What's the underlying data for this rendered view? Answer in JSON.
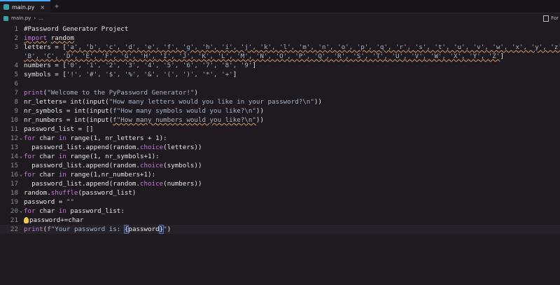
{
  "tab": {
    "title": "main.py",
    "close": "×",
    "new": "+"
  },
  "breadcrumbs": {
    "file": "main.py",
    "sep": "›",
    "more": "..."
  },
  "right_panel": {
    "label": "For"
  },
  "editor": {
    "lines": [
      {
        "n": "1",
        "tokens": [
          {
            "t": "#Password Generator Project",
            "c": "cm"
          }
        ]
      },
      {
        "n": "2",
        "tokens": [
          {
            "t": "import",
            "c": "kw sq"
          },
          {
            "t": " ",
            "c": "id"
          },
          {
            "t": "random",
            "c": "id sq"
          }
        ]
      },
      {
        "n": "3",
        "tokens": [
          {
            "t": "letters = [",
            "c": "id"
          },
          {
            "t": "'a', 'b', 'c', 'd', 'e', 'f', 'g', 'h', 'i', 'j', 'k', 'l', 'm', 'n', 'o', 'p', 'q', 'r', 's', 't', 'u', 'v', 'w', 'x', 'y', 'z', 'A',",
            "c": "str sq"
          }
        ]
      },
      {
        "n": "",
        "tokens": [
          {
            "t": "'B', 'C', 'D', 'E', 'F', 'G', 'H', 'I', 'J', 'K', 'L', 'M', 'N', 'O', 'P', 'Q', 'R', 'S', 'T', 'U', 'V', 'W', 'X', 'Y', 'Z'",
            "c": "str sq"
          },
          {
            "t": "]",
            "c": "id"
          }
        ]
      },
      {
        "n": "4",
        "tokens": [
          {
            "t": "numbers = [",
            "c": "id"
          },
          {
            "t": "'0', '1', '2', '3', '4', '5', '6', '7', '8', '9'",
            "c": "str"
          },
          {
            "t": "]",
            "c": "id"
          }
        ]
      },
      {
        "n": "5",
        "tokens": [
          {
            "t": "symbols = [",
            "c": "id"
          },
          {
            "t": "'!', '#', '$', '%', '&', '(', ')', '*', '+'",
            "c": "str"
          },
          {
            "t": "]",
            "c": "id"
          }
        ]
      },
      {
        "n": "6",
        "tokens": []
      },
      {
        "n": "7",
        "tokens": [
          {
            "t": "print",
            "c": "kw"
          },
          {
            "t": "(",
            "c": "id"
          },
          {
            "t": "\"Welcome to the PyPassword Generator!\"",
            "c": "str"
          },
          {
            "t": ")",
            "c": "id"
          }
        ]
      },
      {
        "n": "8",
        "tokens": [
          {
            "t": "nr_letters= int(input(",
            "c": "id"
          },
          {
            "t": "\"How many letters would you like in your password?\\n\"",
            "c": "str"
          },
          {
            "t": "))",
            "c": "id"
          }
        ]
      },
      {
        "n": "9",
        "tokens": [
          {
            "t": "nr_symbols = int(input(",
            "c": "id"
          },
          {
            "t": "f\"How many symbols would you like?\\n\"",
            "c": "str"
          },
          {
            "t": "))",
            "c": "id"
          }
        ]
      },
      {
        "n": "10",
        "tokens": [
          {
            "t": "nr_numbers = int(input(",
            "c": "id"
          },
          {
            "t": "f\"How many numbers would you like?\\n\"",
            "c": "str sq"
          },
          {
            "t": "))",
            "c": "id"
          }
        ]
      },
      {
        "n": "11",
        "tokens": [
          {
            "t": "password_list = []",
            "c": "id"
          }
        ]
      },
      {
        "n": "12",
        "fold": "⌄",
        "tokens": [
          {
            "t": "for",
            "c": "kw"
          },
          {
            "t": " char ",
            "c": "id"
          },
          {
            "t": "in",
            "c": "kw"
          },
          {
            "t": " range(1, nr_letters + 1):",
            "c": "id"
          }
        ]
      },
      {
        "n": "13",
        "tokens": [
          {
            "t": "  password_list.append(random.",
            "c": "id"
          },
          {
            "t": "choice",
            "c": "kw"
          },
          {
            "t": "(letters))",
            "c": "id"
          }
        ]
      },
      {
        "n": "14",
        "fold": "⌄",
        "tokens": [
          {
            "t": "for",
            "c": "kw"
          },
          {
            "t": " char ",
            "c": "id"
          },
          {
            "t": "in",
            "c": "kw"
          },
          {
            "t": " range(1, nr_symbols+1):",
            "c": "id"
          }
        ]
      },
      {
        "n": "15",
        "tokens": [
          {
            "t": "  password_list.append(random.",
            "c": "id"
          },
          {
            "t": "choice",
            "c": "kw"
          },
          {
            "t": "(symbols))",
            "c": "id"
          }
        ]
      },
      {
        "n": "16",
        "fold": "⌄",
        "tokens": [
          {
            "t": "for",
            "c": "kw"
          },
          {
            "t": " char ",
            "c": "id"
          },
          {
            "t": "in",
            "c": "kw"
          },
          {
            "t": " range(1,nr_numbers+1):",
            "c": "id"
          }
        ]
      },
      {
        "n": "17",
        "tokens": [
          {
            "t": "  password_list.append(random.",
            "c": "id"
          },
          {
            "t": "choice",
            "c": "kw"
          },
          {
            "t": "(numbers))",
            "c": "id"
          }
        ]
      },
      {
        "n": "18",
        "tokens": [
          {
            "t": "random.",
            "c": "id"
          },
          {
            "t": "shuffle",
            "c": "kw"
          },
          {
            "t": "(password_list)",
            "c": "id"
          }
        ]
      },
      {
        "n": "19",
        "tokens": [
          {
            "t": "password = ",
            "c": "id"
          },
          {
            "t": "\"\"",
            "c": "str"
          }
        ]
      },
      {
        "n": "20",
        "fold": "⌄",
        "tokens": [
          {
            "t": "for",
            "c": "kw"
          },
          {
            "t": " char ",
            "c": "id"
          },
          {
            "t": "in",
            "c": "kw"
          },
          {
            "t": " password_list:",
            "c": "id"
          }
        ]
      },
      {
        "n": "21",
        "bulb": true,
        "tokens": [
          {
            "t": "password+=char",
            "c": "id"
          }
        ]
      },
      {
        "n": "22",
        "current": true,
        "tokens": [
          {
            "t": "print",
            "c": "kw"
          },
          {
            "t": "(",
            "c": "id"
          },
          {
            "t": "f\"Your password is: ",
            "c": "str"
          },
          {
            "t": "{",
            "c": "id bracket-hl"
          },
          {
            "t": "password",
            "c": "id"
          },
          {
            "t": "}",
            "c": "id bracket-hl"
          },
          {
            "t": "\"",
            "c": "str"
          },
          {
            "t": ")",
            "c": "id"
          }
        ]
      }
    ]
  }
}
